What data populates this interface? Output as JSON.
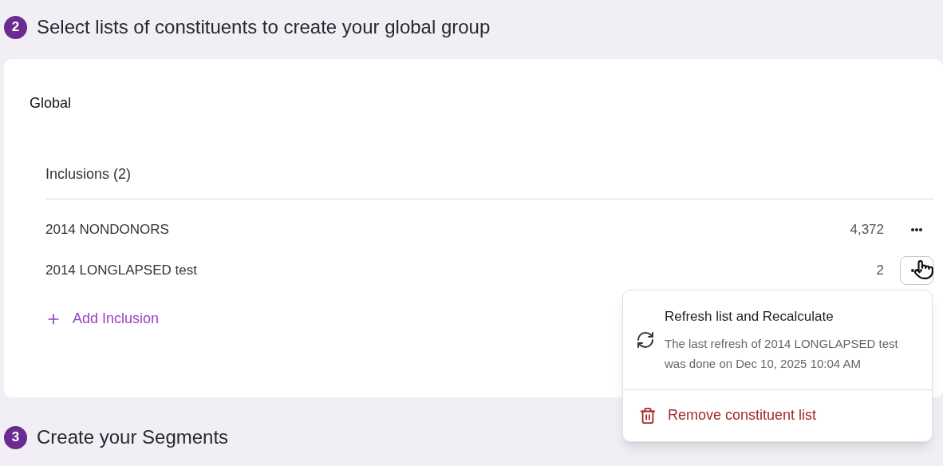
{
  "steps": [
    {
      "number": "2",
      "title": "Select lists of constituents to create your global group"
    },
    {
      "number": "3",
      "title": "Create your Segments"
    }
  ],
  "card": {
    "title": "Global",
    "section_title": "Inclusions (2)",
    "rows": [
      {
        "name": "2014 NONDONORS",
        "count": "4,372",
        "menu_open": false
      },
      {
        "name": "2014 LONGLAPSED test",
        "count": "2",
        "menu_open": true
      }
    ],
    "add_label": "Add Inclusion"
  },
  "menu": {
    "items": [
      {
        "kind": "refresh",
        "title": "Refresh list and Recalculate",
        "description": "The last refresh of 2014 LONGLAPSED test was done on Dec 10, 2025 10:04 AM"
      },
      {
        "kind": "remove",
        "title": "Remove constituent list"
      }
    ]
  }
}
